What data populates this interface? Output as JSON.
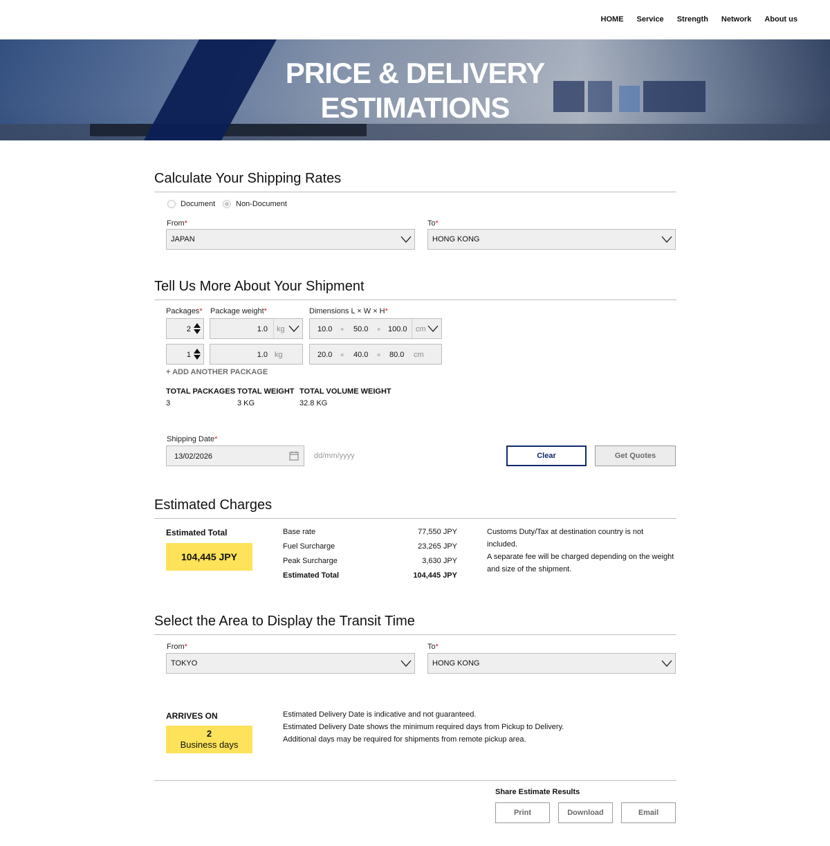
{
  "nav": {
    "items": [
      "HOME",
      "Service",
      "Strength",
      "Network",
      "About us"
    ]
  },
  "hero": {
    "title_line1": "PRICE & DELIVERY",
    "title_line2": "ESTIMATIONS"
  },
  "shipping_rates": {
    "title": "Calculate Your Shipping Rates",
    "radio_document": "Document",
    "radio_non_document": "Non-Document",
    "selected_type": "Non-Document",
    "from_label": "From",
    "from_value": "JAPAN",
    "to_label": "To",
    "to_value": "HONG KONG",
    "required_mark": "*"
  },
  "shipment": {
    "title": "Tell Us More About Your Shipment",
    "packages_label": "Packages",
    "weight_label": "Package weight",
    "dimensions_label": "Dimensions L × W × H",
    "rows": [
      {
        "packages": "2",
        "weight": "1.0",
        "weight_unit": "kg",
        "l": "10.0",
        "w": "50.0",
        "h": "100.0",
        "dim_unit": "cm"
      },
      {
        "packages": "1",
        "weight": "1.0",
        "weight_unit": "kg",
        "l": "20.0",
        "w": "40.0",
        "h": "80.0",
        "dim_unit": "cm"
      }
    ],
    "times": "×",
    "add_package": "+ ADD ANOTHER PACKAGE",
    "total_packages_label": "TOTAL PACKAGES",
    "total_packages_value": "3",
    "total_weight_label": "TOTAL WEIGHT",
    "total_weight_value": "3 KG",
    "total_volume_label": "TOTAL VOLUME WEIGHT",
    "total_volume_value": "32.8 KG",
    "date_label": "Shipping Date",
    "date_value": "13/02/2026",
    "date_hint": "dd/mm/yyyy",
    "clear_button": "Clear",
    "quotes_button": "Get Quotes"
  },
  "charges": {
    "title": "Estimated Charges",
    "total_label": "Estimated Total",
    "total_value": "104,445 JPY",
    "rows": [
      {
        "label": "Base rate",
        "value": "77,550 JPY"
      },
      {
        "label": "Fuel Surcharge",
        "value": "23,265 JPY"
      },
      {
        "label": "Peak Surcharge",
        "value": "3,630 JPY"
      },
      {
        "label": "Estimated Total",
        "value": "104,445 JPY"
      }
    ],
    "note1a": "Customs Duty/Tax at destination country is not",
    "note1b": "included.",
    "note2a": "A separate fee will be charged depending on the weight",
    "note2b": "and size of the shipment."
  },
  "transit": {
    "title": "Select the Area to Display the Transit Time",
    "from_label": "From",
    "from_value": "TOKYO",
    "to_label": "To",
    "to_value": "HONG KONG",
    "arrives_label": "ARRIVES ON",
    "days_number": "2",
    "days_text": "Business days",
    "note1": "Estimated Delivery Date is indicative and not guaranteed.",
    "note2": "Estimated Delivery Date shows the minimum required days from Pickup to Delivery.",
    "note3": "Additional days may be required for shipments from remote pickup area."
  },
  "share": {
    "title": "Share Estimate Results",
    "print": "Print",
    "download": "Download",
    "email": "Email"
  },
  "colors": {
    "accent_navy": "#0f2a6b",
    "highlight_yellow": "#fde25a",
    "required_red": "#d31b1b"
  }
}
